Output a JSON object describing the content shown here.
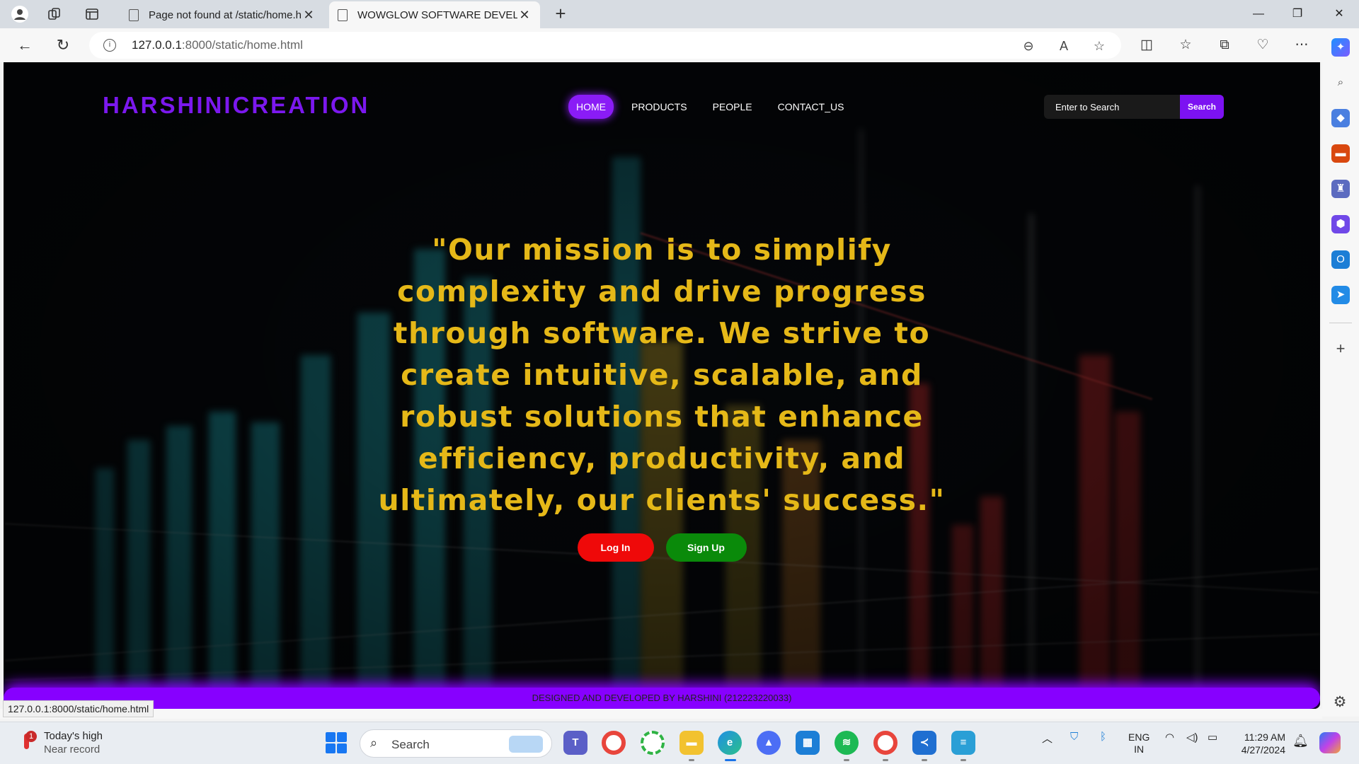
{
  "browser": {
    "tabs": [
      {
        "title": "Page not found at /static/home.h",
        "active": false
      },
      {
        "title": "WOWGLOW SOFTWARE DEVELO",
        "active": true
      }
    ],
    "url_host": "127.0.0.1",
    "url_path": ":8000/static/home.html",
    "status_url": "127.0.0.1:8000/static/home.html"
  },
  "site": {
    "brand": "HARSHINICREATION",
    "menu": [
      {
        "label": "HOME",
        "active": true
      },
      {
        "label": "PRODUCTS",
        "active": false
      },
      {
        "label": "PEOPLE",
        "active": false
      },
      {
        "label": "CONTACT_US",
        "active": false
      }
    ],
    "search": {
      "placeholder": "Enter to Search",
      "button": "Search"
    },
    "mission": "\"Our mission is to simplify complexity and drive progress through software. We strive to create intuitive, scalable, and robust solutions that enhance efficiency, productivity, and ultimately, our clients' success.\"",
    "login_label": "Log In",
    "signup_label": "Sign Up",
    "footer": "DESIGNED AND DEVELOPED BY HARSHINI (212223220033)",
    "colors": {
      "brand": "#7b18ee",
      "mission_text": "#e5b818",
      "login": "#ef0909",
      "signup": "#0a8a0a",
      "footer": "#8700ff"
    }
  },
  "taskbar": {
    "weather_title": "Today's high",
    "weather_sub": "Near record",
    "weather_badge": "1",
    "search_label": "Search",
    "lang_line1": "ENG",
    "lang_line2": "IN",
    "time": "11:29 AM",
    "date": "4/27/2024"
  }
}
